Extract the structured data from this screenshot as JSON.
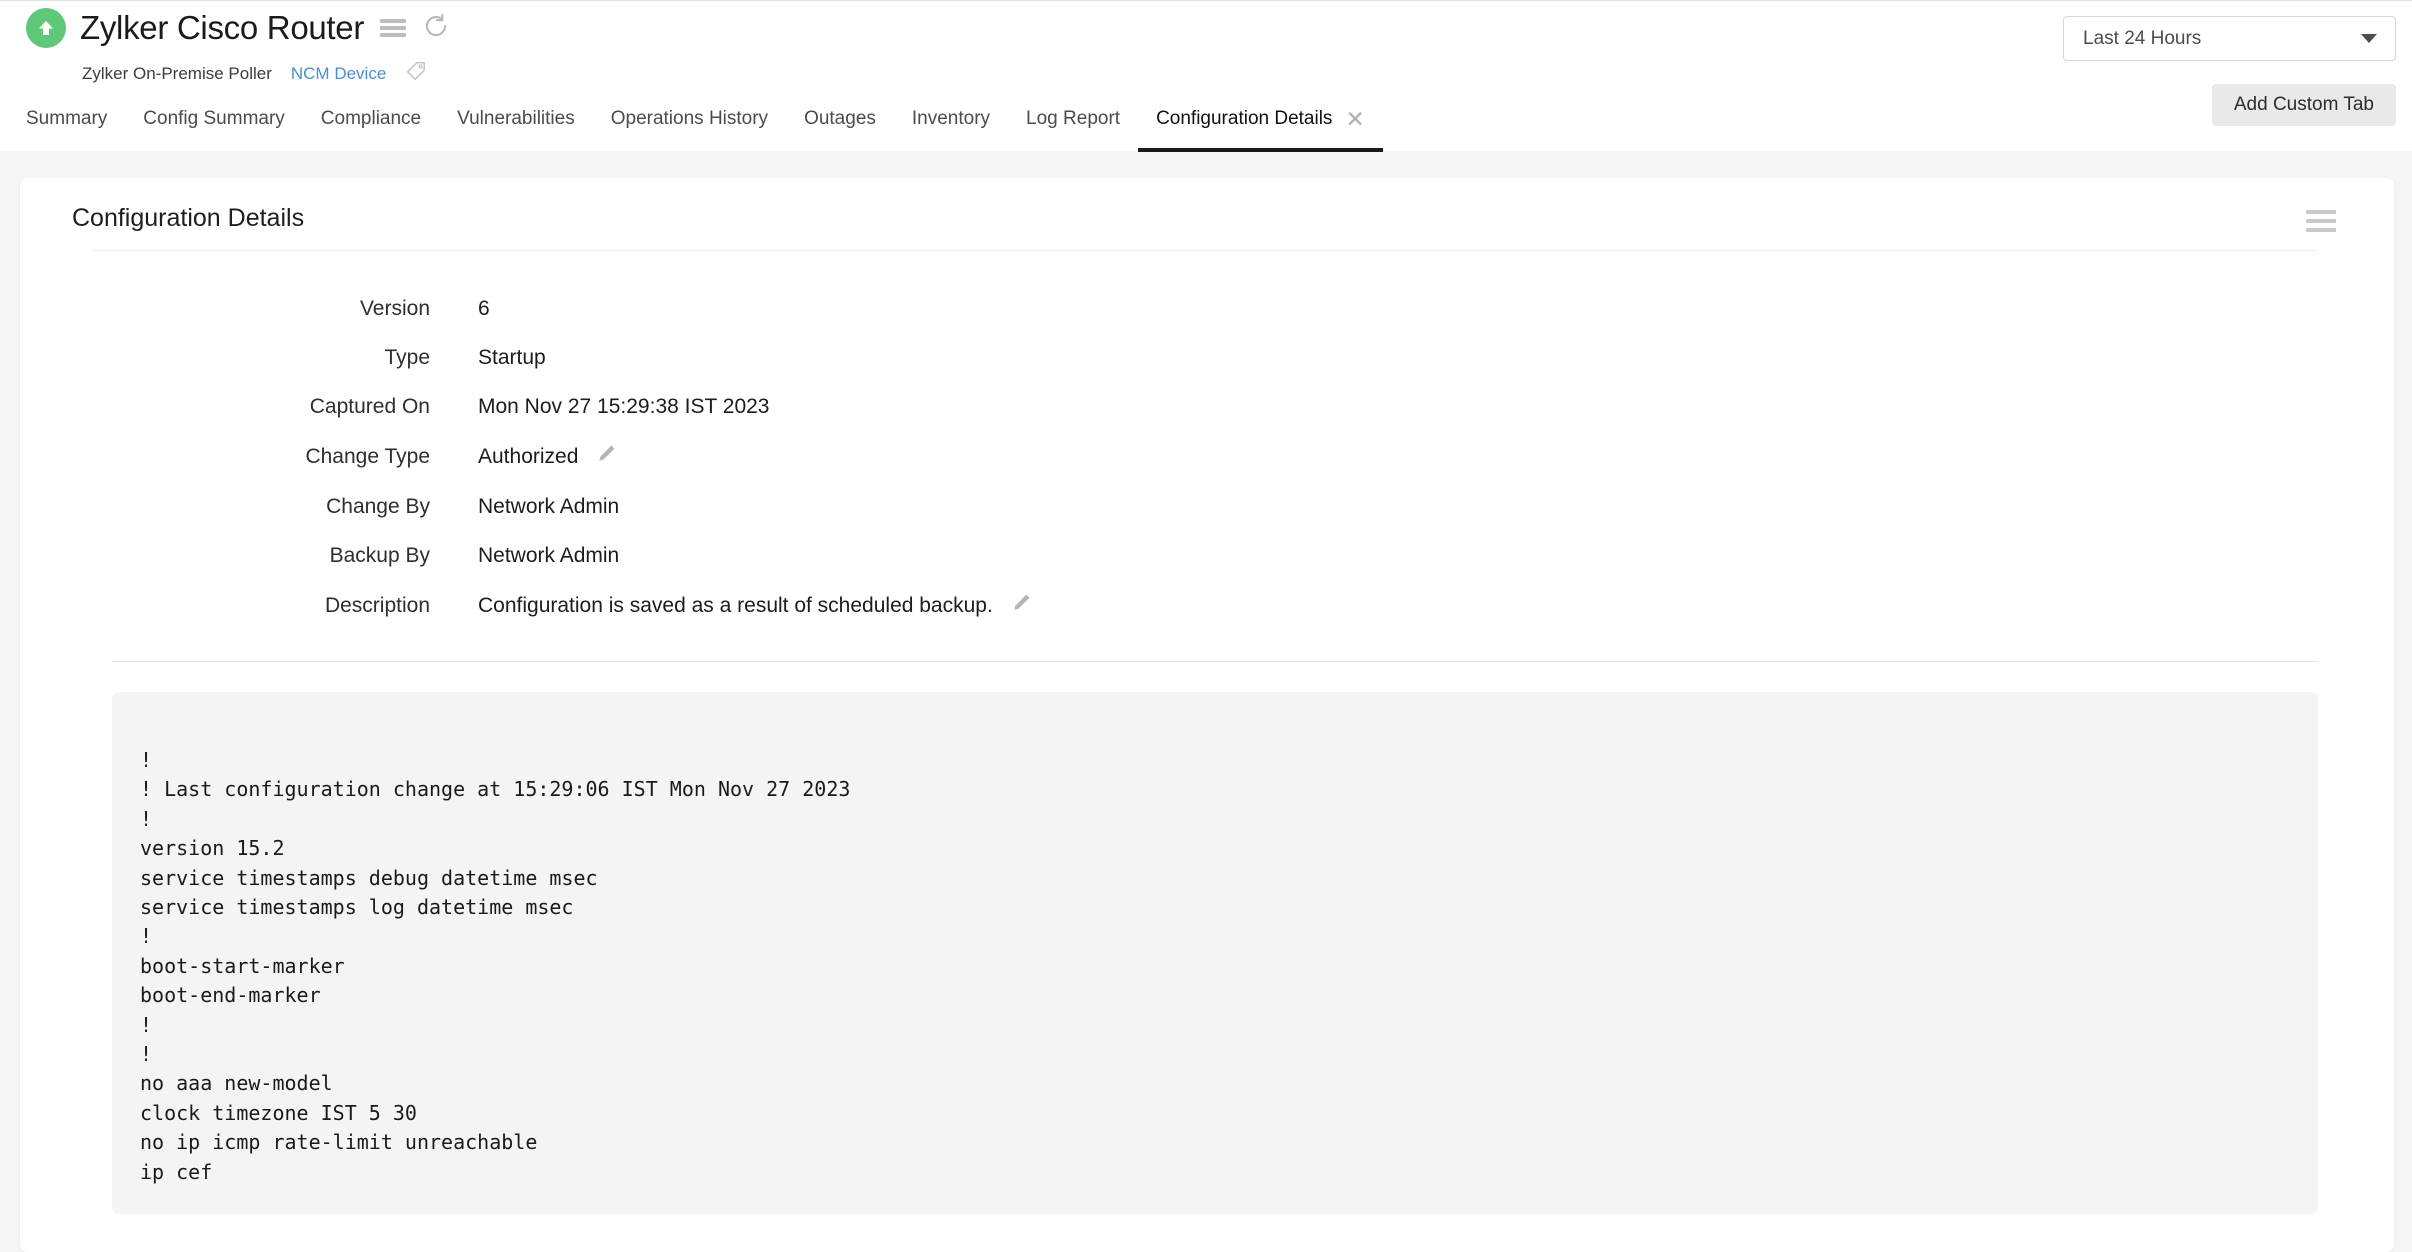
{
  "header": {
    "status_icon": "arrow-up-circle-icon",
    "status_color": "#5ec878",
    "device_title": "Zylker Cisco Router",
    "menu_icon": "hamburger-menu-icon",
    "refresh_icon": "refresh-icon",
    "poller_name": "Zylker On-Premise Poller",
    "ncm_link": "NCM Device",
    "ncm_link_color": "#4a8fd4",
    "tag_icon": "tag-icon"
  },
  "period": {
    "value": "Last 24 Hours",
    "caret_icon": "chevron-down-icon"
  },
  "add_custom_tab_label": "Add Custom Tab",
  "tabs": [
    {
      "label": "Summary",
      "active": false
    },
    {
      "label": "Config Summary",
      "active": false
    },
    {
      "label": "Compliance",
      "active": false
    },
    {
      "label": "Vulnerabilities",
      "active": false
    },
    {
      "label": "Operations History",
      "active": false
    },
    {
      "label": "Outages",
      "active": false
    },
    {
      "label": "Inventory",
      "active": false
    },
    {
      "label": "Log Report",
      "active": false
    },
    {
      "label": "Configuration Details",
      "active": true,
      "close_icon": "close-icon",
      "close_glyph": "✕"
    }
  ],
  "card": {
    "title": "Configuration Details",
    "menu_icon": "hamburger-menu-icon"
  },
  "details": [
    {
      "label": "Version",
      "value": "6",
      "editable": false
    },
    {
      "label": "Type",
      "value": "Startup",
      "editable": false
    },
    {
      "label": "Captured On",
      "value": "Mon Nov 27 15:29:38 IST 2023",
      "editable": false
    },
    {
      "label": "Change Type",
      "value": "Authorized",
      "editable": true
    },
    {
      "label": "Change By",
      "value": "Network Admin",
      "editable": false
    },
    {
      "label": "Backup By",
      "value": "Network Admin",
      "editable": false
    },
    {
      "label": "Description",
      "value": "Configuration is saved as a result of scheduled backup.",
      "editable": true
    }
  ],
  "config_text": "!\n! Last configuration change at 15:29:06 IST Mon Nov 27 2023\n!\nversion 15.2\nservice timestamps debug datetime msec\nservice timestamps log datetime msec\n!\nboot-start-marker\nboot-end-marker\n!\n!\nno aaa new-model\nclock timezone IST 5 30\nno ip icmp rate-limit unreachable\nip cef"
}
